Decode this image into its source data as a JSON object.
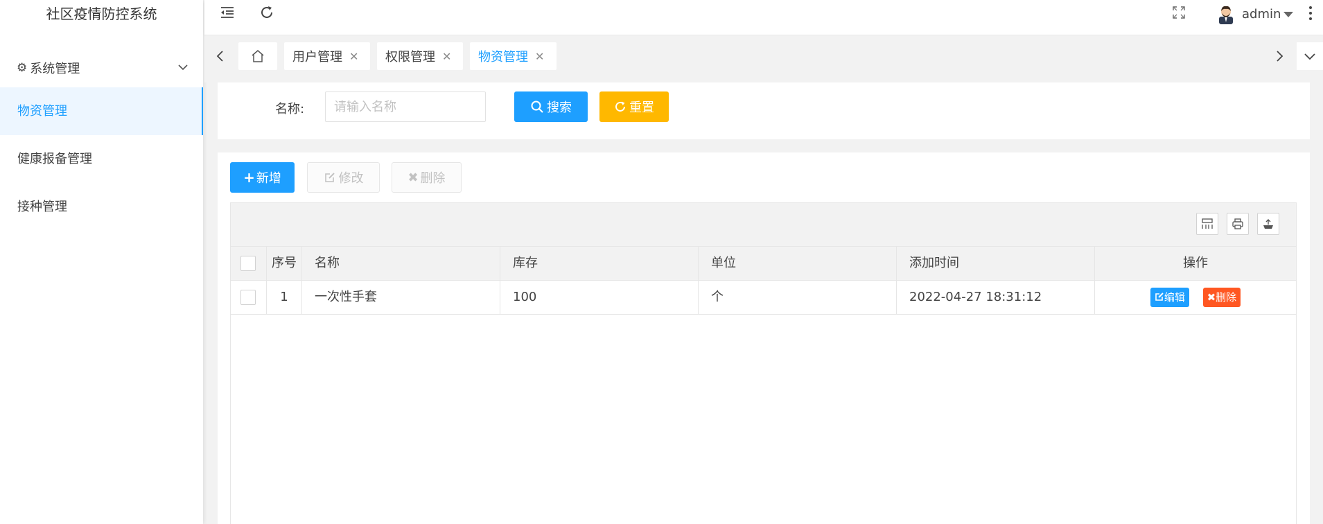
{
  "app": {
    "title": "社区疫情防控系统"
  },
  "sidebar": {
    "group": {
      "label": "系统管理"
    },
    "items": [
      {
        "label": "物资管理"
      },
      {
        "label": "健康报备管理"
      },
      {
        "label": "接种管理"
      }
    ]
  },
  "header": {
    "user": "admin"
  },
  "tabs": [
    {
      "label": "用户管理"
    },
    {
      "label": "权限管理"
    },
    {
      "label": "物资管理"
    }
  ],
  "search": {
    "name_label": "名称:",
    "placeholder": "请输入名称",
    "search_button": "搜索",
    "reset_button": "重置"
  },
  "actions": {
    "add": "新增",
    "edit": "修改",
    "delete": "删除"
  },
  "table": {
    "columns": [
      "序号",
      "名称",
      "库存",
      "单位",
      "添加时间",
      "操作"
    ],
    "rows": [
      {
        "index": "1",
        "name": "一次性手套",
        "stock": "100",
        "unit": "个",
        "added": "2022-04-27 18:31:12",
        "edit": "编辑",
        "delete": "删除"
      }
    ]
  },
  "colors": {
    "primary": "#1e9fff",
    "warning": "#ffb800",
    "danger": "#ff5722"
  }
}
